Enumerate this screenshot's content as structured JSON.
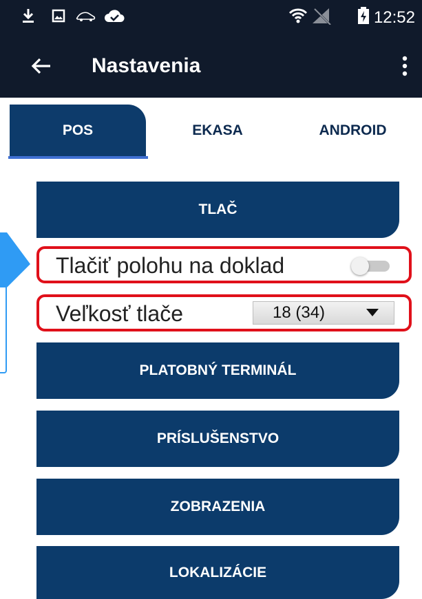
{
  "status_bar": {
    "time": "12:52",
    "icons": [
      "download-icon",
      "image-icon",
      "car-icon",
      "cloud-check-icon",
      "wifi-icon",
      "no-signal-icon",
      "battery-charging-icon"
    ]
  },
  "app_bar": {
    "title": "Nastavenia",
    "back_icon": "arrow-left-icon",
    "more_icon": "more-vertical-icon"
  },
  "tabs": [
    {
      "label": "POS",
      "active": true
    },
    {
      "label": "EKASA",
      "active": false
    },
    {
      "label": "ANDROID",
      "active": false
    }
  ],
  "menu": {
    "tlac": "TLAČ",
    "platobny_terminal": "PLATOBNÝ TERMINÁL",
    "prislusenstvo": "PRÍSLUŠENSTVO",
    "zobrazenia": "ZOBRAZENIA",
    "lokalizacie": "LOKALIZÁCIE"
  },
  "settings": {
    "print_position_label": "Tlačiť polohu na doklad",
    "print_position_enabled": false,
    "print_size_label": "Veľkosť tlače",
    "print_size_value": "18 (34)"
  },
  "colors": {
    "app_bar": "#101a2b",
    "primary": "#0c3b6b",
    "highlight": "#e0101a",
    "callout": "#2f9bf4",
    "tab_indicator": "#3f6fd2"
  }
}
